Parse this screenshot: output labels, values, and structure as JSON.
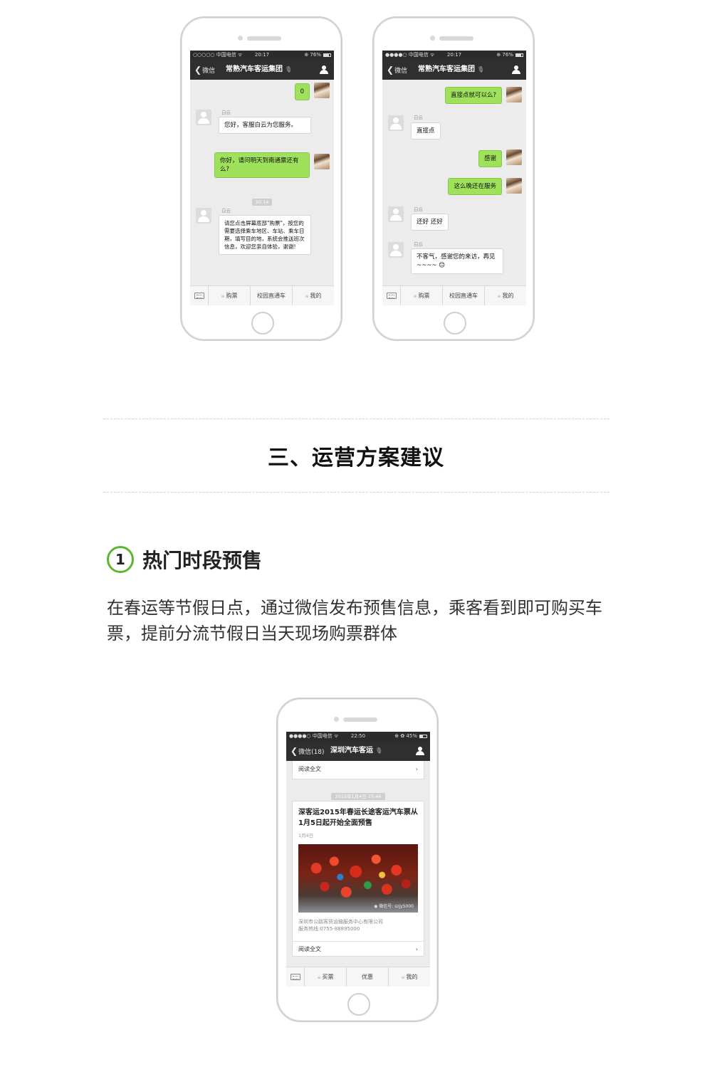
{
  "phones": [
    {
      "status": {
        "carrier": "○○○○○ 中国电信 ᯤ",
        "time": "20:17",
        "right": "⊕ 76%",
        "battery_fraction": 0.76
      },
      "nav": {
        "back": "微信",
        "title": "常熟汽车客运集团",
        "title_ear": "🎙"
      },
      "messages": [
        {
          "side": "right",
          "text": "0"
        },
        {
          "side": "left",
          "sender": "白云",
          "text": "您好，客服白云为您服务。"
        },
        {
          "side": "right",
          "text": "你好，请问明天到南通票还有么?"
        },
        {
          "type": "time",
          "text": "20:14"
        },
        {
          "side": "left",
          "sender": "白云",
          "text": "请您点击屏幕底部\"购票\"，按您的需要选择乘车地区、车站、乘车日期，填写目的地，系统会推送班次信息，欢迎您亲自体验，谢谢!"
        }
      ],
      "menu": [
        "购票",
        "校园直通车",
        "我的"
      ]
    },
    {
      "status": {
        "carrier": "●●●●○ 中国电信 ᯤ",
        "time": "20:17",
        "right": "⊕ 76%",
        "battery_fraction": 0.76
      },
      "nav": {
        "back": "微信",
        "title": "常熟汽车客运集团",
        "title_ear": "🎙"
      },
      "messages": [
        {
          "side": "right",
          "text": "直接点就可以么?"
        },
        {
          "side": "left",
          "sender": "白云",
          "text": "直接点"
        },
        {
          "side": "right",
          "text": "感谢"
        },
        {
          "side": "right",
          "text": "这么晚还在服务"
        },
        {
          "side": "left",
          "sender": "白云",
          "text": "还好 还好"
        },
        {
          "side": "left",
          "sender": "白云",
          "text": "不客气，感谢您的来访，再见~~~~ 😊"
        }
      ],
      "menu": [
        "购票",
        "校园直通车",
        "我的"
      ]
    },
    {
      "status": {
        "carrier": "●●●●○ 中国电信 ᯤ",
        "time": "22:50",
        "right": "⊕ ✿ 45%",
        "battery_fraction": 0.45
      },
      "nav": {
        "back": "微信(18)",
        "title": "深圳汽车客运",
        "title_ear": "🎙"
      },
      "read_more": "阅读全文",
      "timestamp": "2015年1月4日 15:46",
      "card": {
        "title": "深客运2015年春运长途客运汽车票从1月5日起开始全面预售",
        "date": "1月4日",
        "watermark": "◉ 微信号: szjy5000",
        "footer_line1": "深圳市公路客货运输服务中心有限公司",
        "footer_line2": "服务热线:0755-88895000",
        "read_more": "阅读全文"
      },
      "menu": [
        "买票",
        "优惠",
        "我的"
      ]
    }
  ],
  "section": {
    "title": "三、运营方案建议",
    "sub_number": "1",
    "sub_title": "热门时段预售",
    "paragraph": "在春运等节假日点，通过微信发布预售信息，乘客看到即可购买车票，提前分流节假日当天现场购票群体"
  },
  "icons": {
    "back": "chevron-left-icon",
    "contact": "person-icon",
    "keyboard": "keyboard-icon",
    "menu_dots": "menu-dots-icon",
    "arrow": "chevron-right-icon"
  },
  "colors": {
    "accent_green": "#5cb531",
    "bubble_green": "#9fe15a",
    "navbar": "#2f2f2f"
  }
}
